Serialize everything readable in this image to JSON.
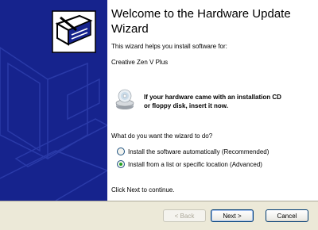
{
  "wizard": {
    "title": "Welcome to the Hardware Update Wizard",
    "intro": "This wizard helps you install software for:",
    "device": "Creative Zen V Plus",
    "cd_note_line1": "If your hardware came with an installation CD",
    "cd_note_line2": "or floppy disk, insert it now.",
    "question": "What do you want the wizard to do?",
    "options": [
      {
        "label": "Install the software automatically (Recommended)",
        "selected": false
      },
      {
        "label": "Install from a list or specific location (Advanced)",
        "selected": true
      }
    ],
    "footer": "Click Next to continue."
  },
  "buttons": {
    "back": "< Back",
    "next": "Next >",
    "cancel": "Cancel"
  },
  "colors": {
    "sidebar": "#16238d",
    "button_bar": "#ece9d8"
  },
  "icons": [
    "hardware-wizard-icon",
    "cd-drive-icon"
  ]
}
